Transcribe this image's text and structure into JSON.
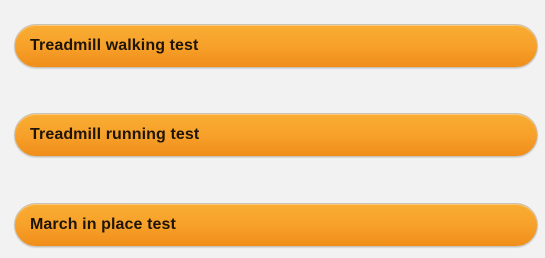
{
  "tests": [
    {
      "label": "Treadmill walking test"
    },
    {
      "label": "Treadmill running test"
    },
    {
      "label": "March in place test"
    }
  ],
  "colors": {
    "background": "#f2f2f2",
    "button_top": "#f9ad32",
    "button_bottom": "#f08e1a",
    "button_border": "#c9c2b6",
    "label_text": "#1f1408"
  }
}
